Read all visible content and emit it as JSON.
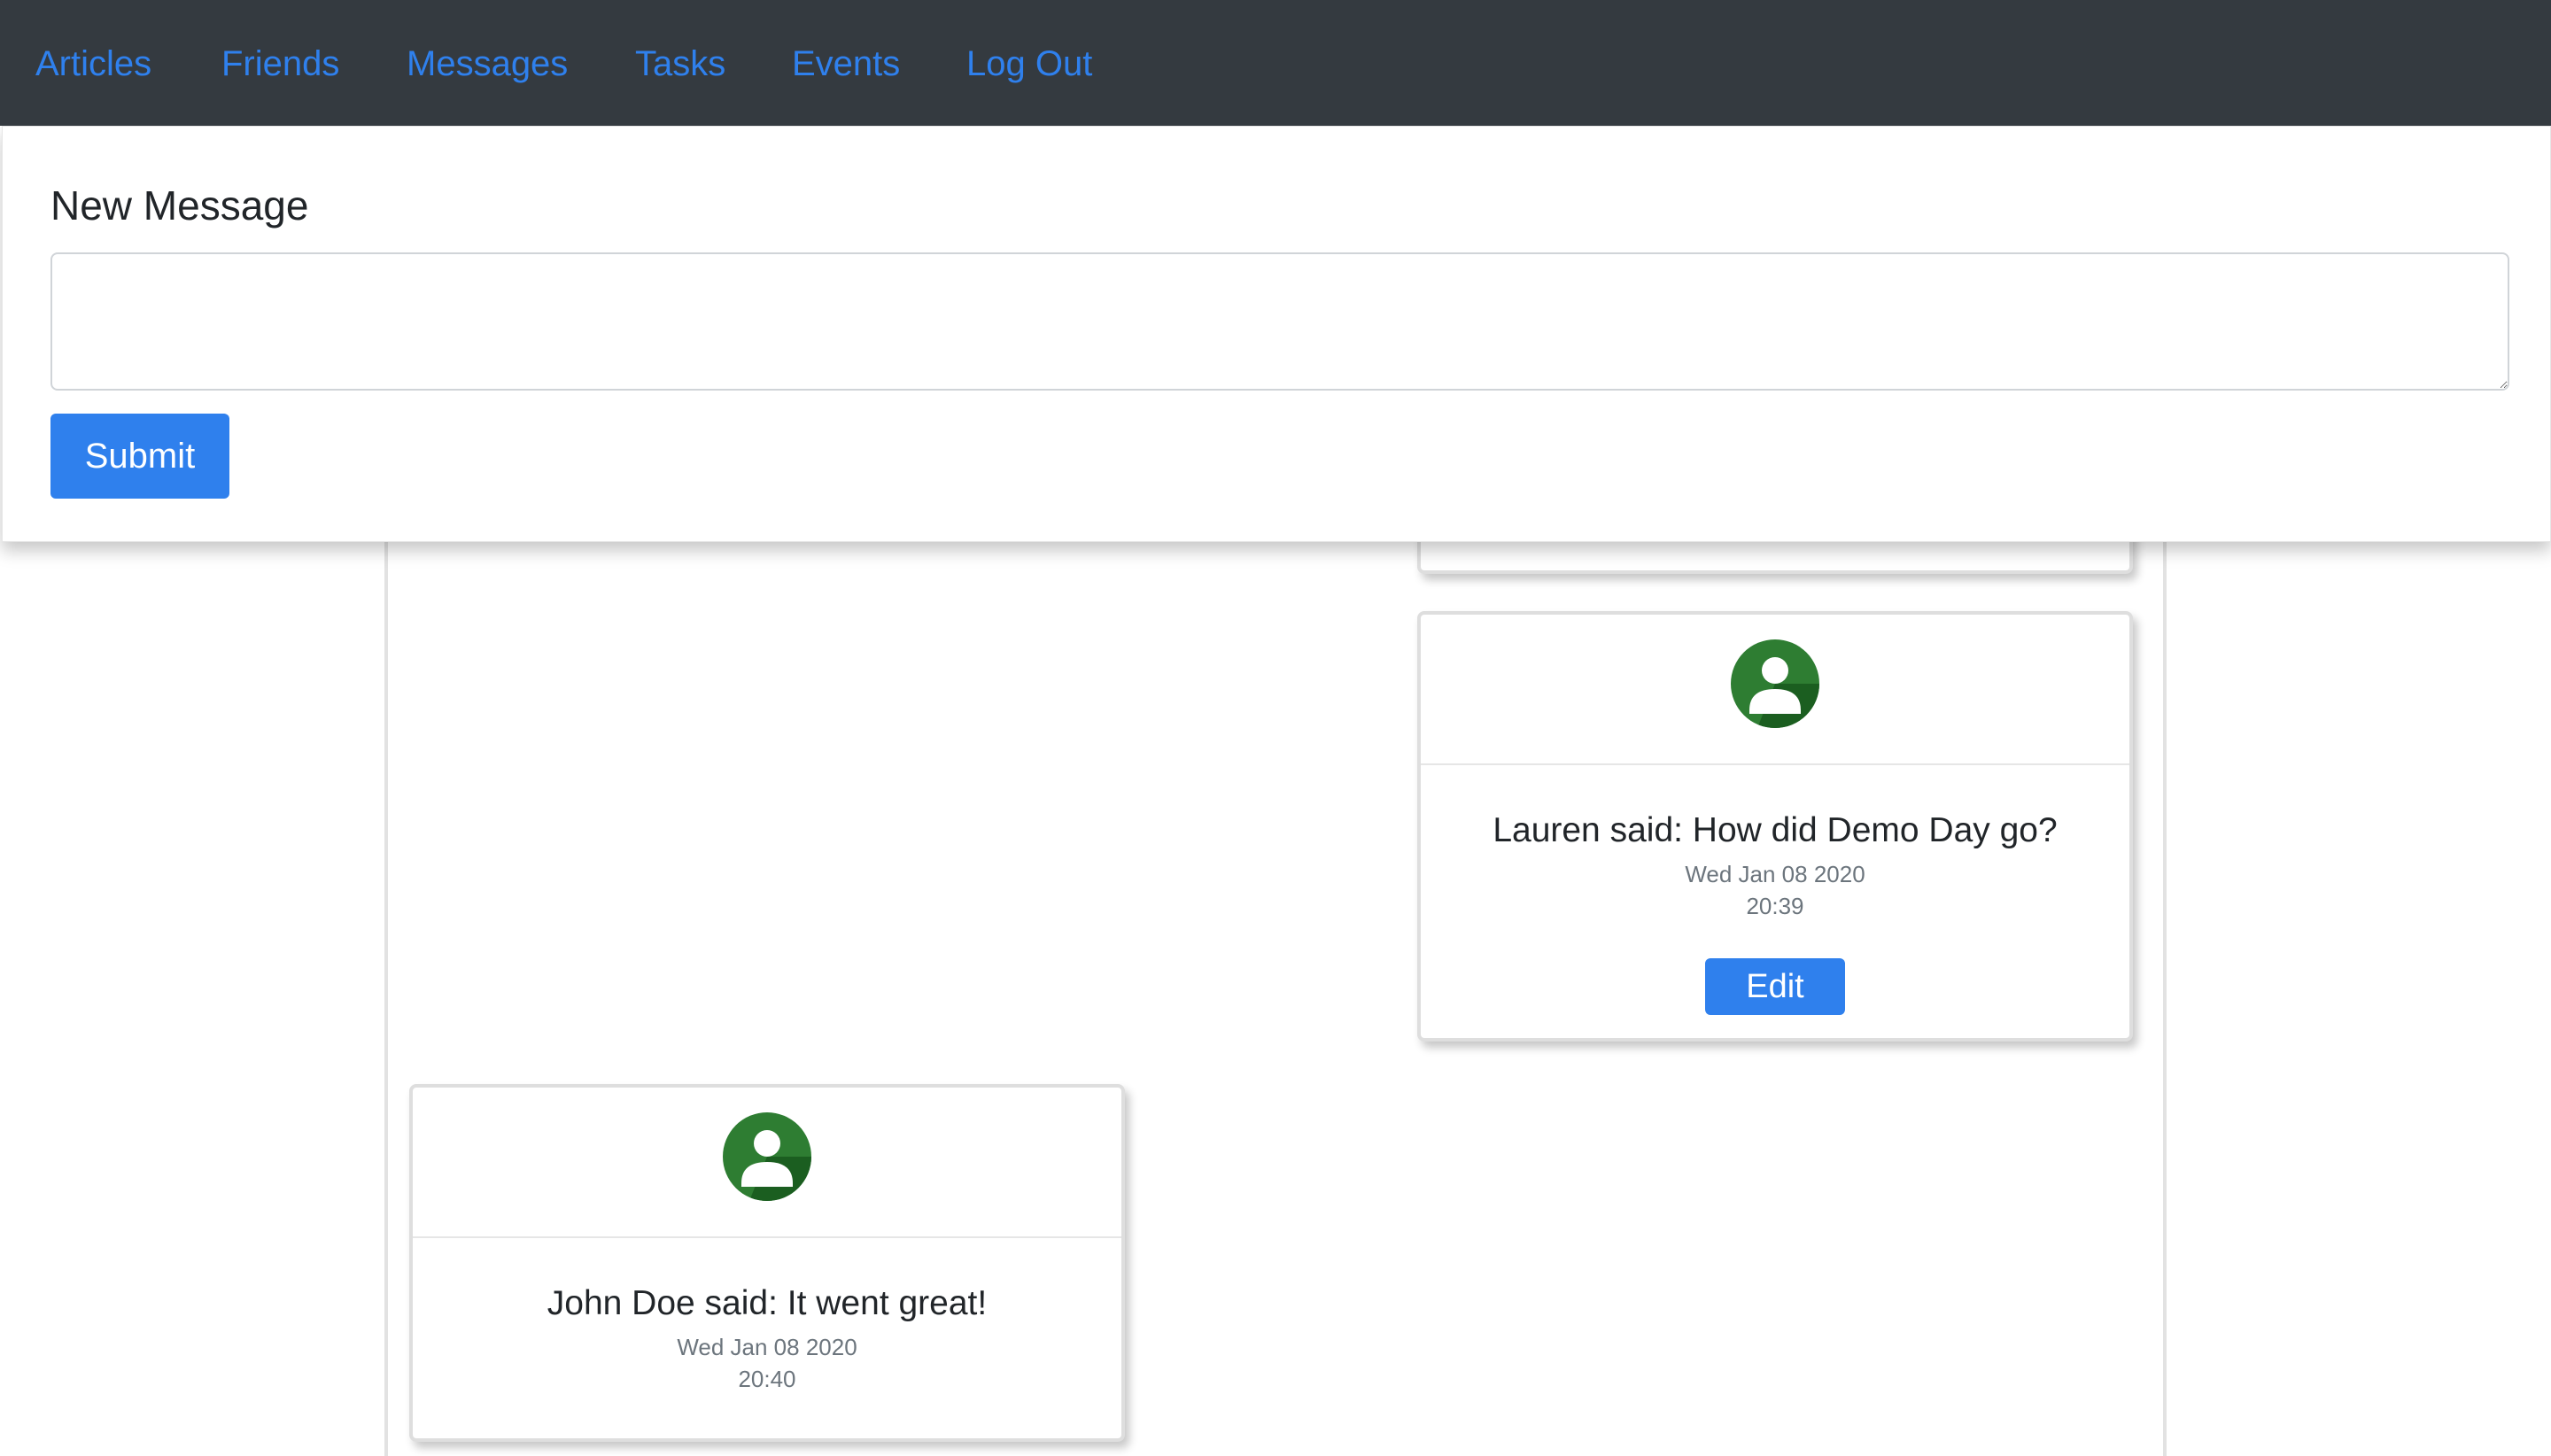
{
  "nav": {
    "items": [
      "Articles",
      "Friends",
      "Messages",
      "Tasks",
      "Events",
      "Log Out"
    ]
  },
  "compose": {
    "title": "New Message",
    "input_value": "",
    "input_placeholder": "",
    "submit_label": "Submit"
  },
  "messages": [
    {
      "text": "Lauren said: How did Demo Day go?",
      "date": "Wed Jan 08 2020",
      "time": "20:39",
      "edit_label": "Edit"
    },
    {
      "text": "John Doe said: It went great!",
      "date": "Wed Jan 08 2020",
      "time": "20:40"
    }
  ],
  "colors": {
    "navbar": "#343a40",
    "link": "#2f80ed",
    "primary_button": "#2f80ed",
    "avatar_green": "#2e7d32"
  },
  "icons": {
    "avatar": "user-avatar-icon"
  }
}
